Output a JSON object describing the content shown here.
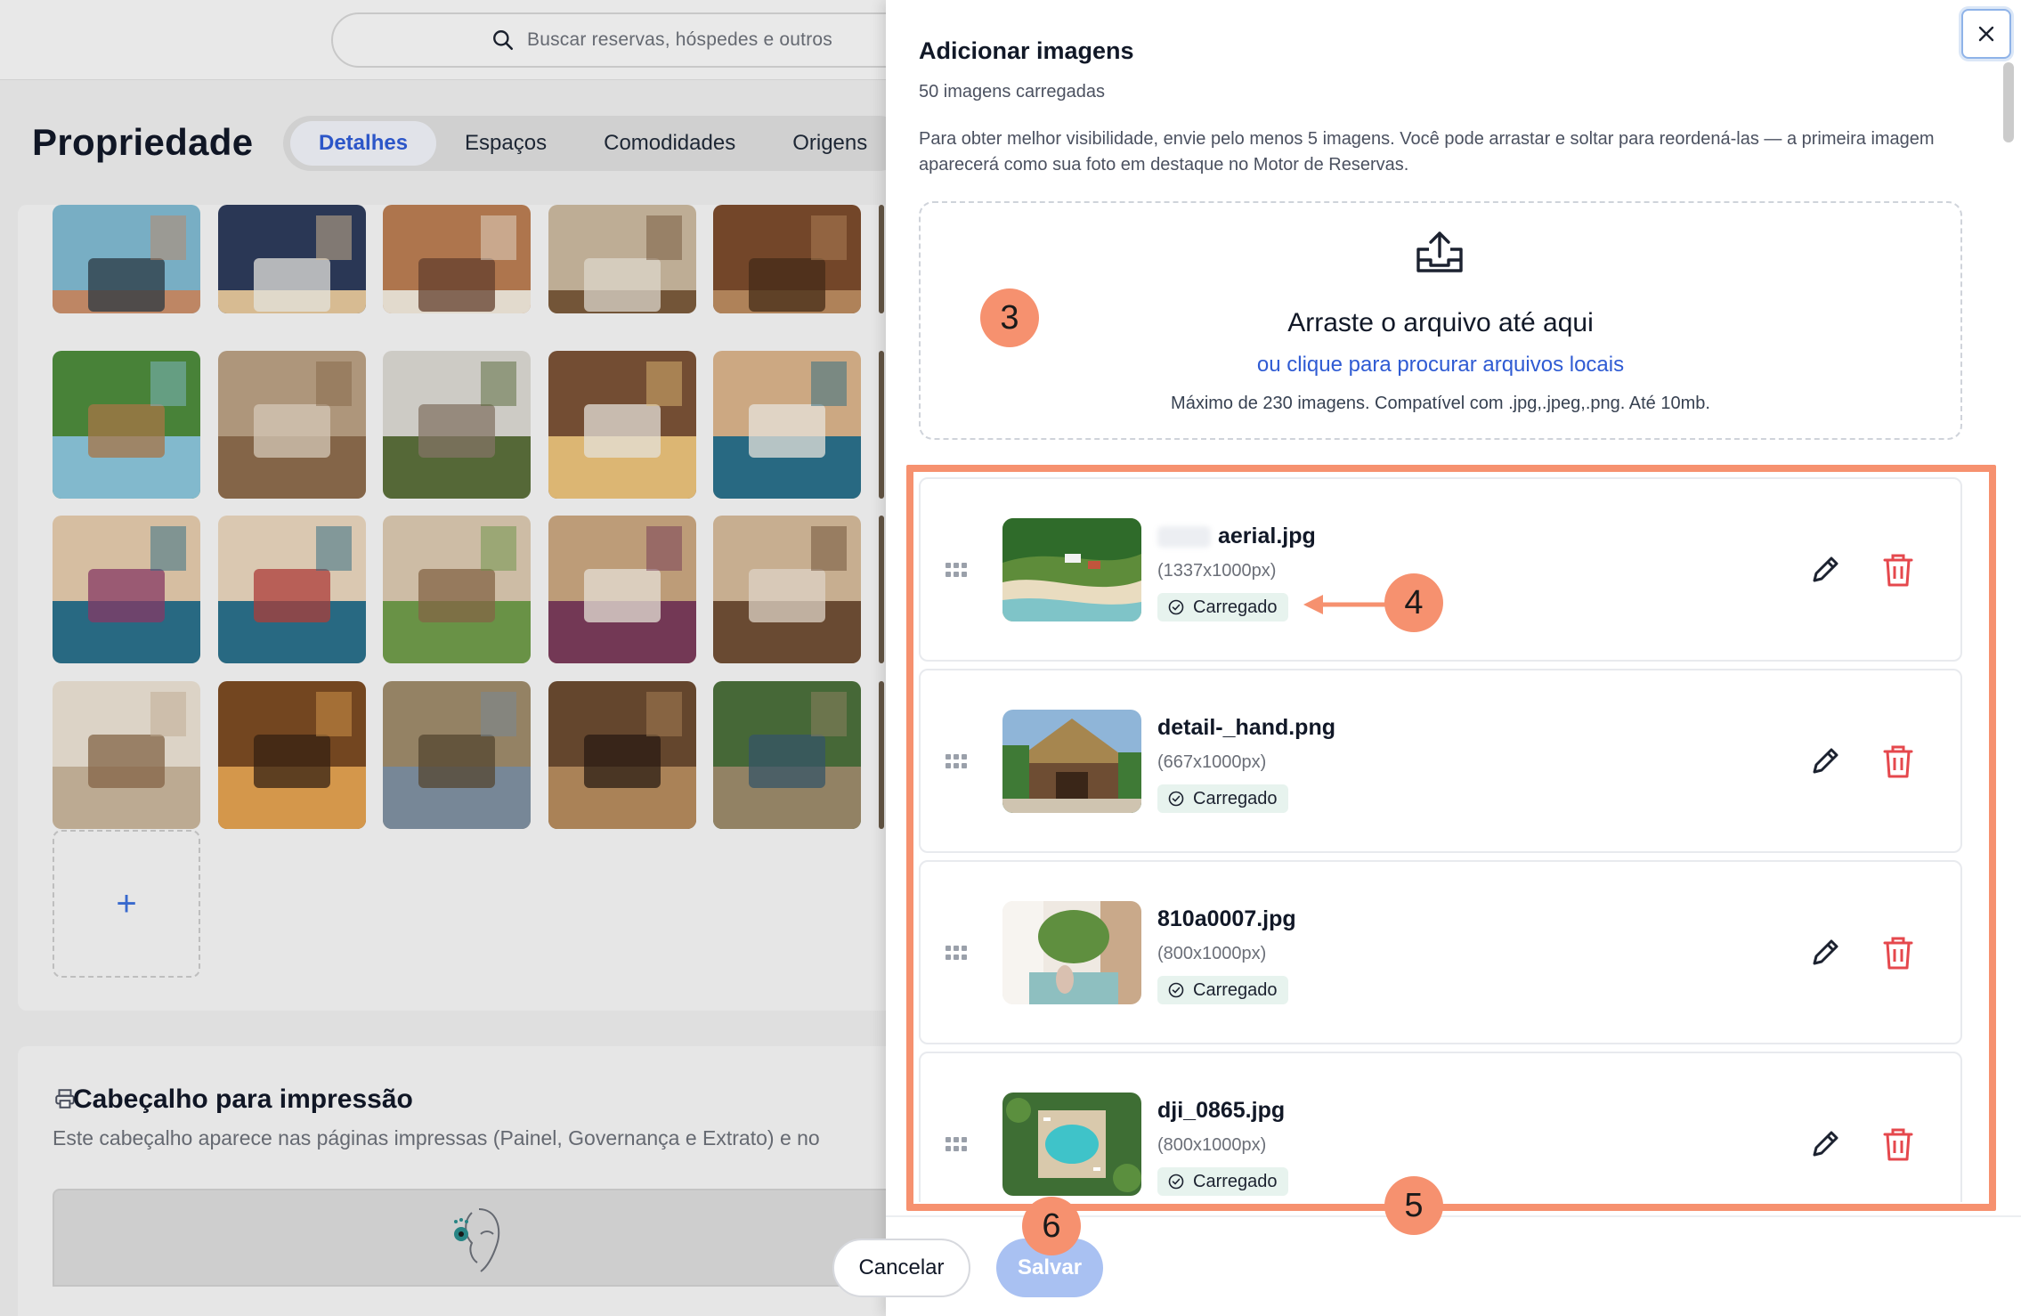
{
  "search": {
    "placeholder": "Buscar reservas, hóspedes e outros"
  },
  "page": {
    "title": "Propriedade"
  },
  "tabs": [
    {
      "label": "Detalhes",
      "active": true
    },
    {
      "label": "Espaços"
    },
    {
      "label": "Comodidades"
    },
    {
      "label": "Origens"
    }
  ],
  "gallery": {
    "add_label": "+",
    "thumbnails": [
      "beach-couple",
      "breakfast-table",
      "balcony-stairs",
      "room-desk",
      "stone-shower",
      "pool-garden",
      "room-chair",
      "woman-reading",
      "breakfast-tray",
      "bedroom-fish-art",
      "bedroom-fish-art-2",
      "bedroom-ac",
      "balcony-palms",
      "room-patterned-bed",
      "room-window",
      "bright-bedroom",
      "wood-lounge",
      "beach-hammocks",
      "wooden-door",
      "garden-path"
    ]
  },
  "print_header": {
    "title": "Cabeçalho para impressão",
    "description": "Este cabeçalho aparece nas páginas impressas (Painel, Governança e Extrato) e no"
  },
  "panel": {
    "title": "Adicionar imagens",
    "count": "50 imagens carregadas",
    "description": "Para obter melhor visibilidade, envie pelo menos 5 imagens. Você pode arrastar e soltar para reordená-las — a primeira imagem aparecerá como sua foto em destaque no Motor de Reservas.",
    "dropzone": {
      "title": "Arraste o arquivo até aqui",
      "link": "ou clique para procurar arquivos locais",
      "note": "Máximo de 230 imagens. Compatível com .jpg,.jpeg,.png. Até 10mb."
    },
    "files": [
      {
        "name": "aerial.jpg",
        "dims": "(1337x1000px)",
        "status": "Carregado",
        "thumb": "aerial-beach"
      },
      {
        "name": "detail-_hand.png",
        "dims": "(667x1000px)",
        "status": "Carregado",
        "thumb": "thatched-entrance"
      },
      {
        "name": "810a0007.jpg",
        "dims": "(800x1000px)",
        "status": "Carregado",
        "thumb": "courtyard"
      },
      {
        "name": "dji_0865.jpg",
        "dims": "(800x1000px)",
        "status": "Carregado",
        "thumb": "pool-aerial"
      }
    ],
    "cancel_label": "Cancelar",
    "save_label": "Salvar"
  },
  "annotations": {
    "m3": "3",
    "m4": "4",
    "m5": "5",
    "m6": "6"
  },
  "colors": {
    "accent": "#2f5bd3",
    "annotation": "#f6916f",
    "delete": "#e5484d",
    "save_disabled": "#a9c1f2"
  }
}
